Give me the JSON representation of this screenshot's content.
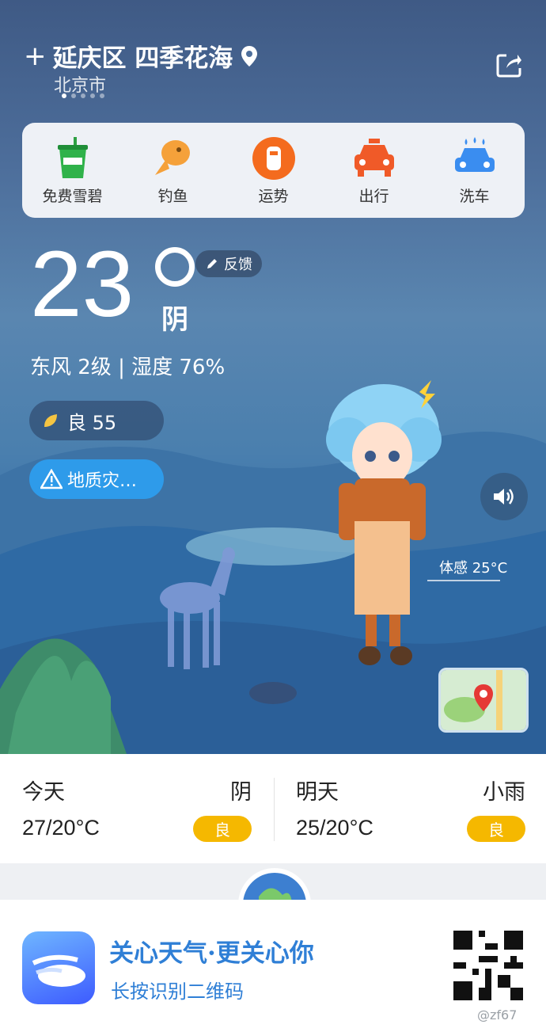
{
  "location": {
    "name": "延庆区 四季花海",
    "city": "北京市",
    "page_dots": 5,
    "active_dot": 0
  },
  "services": [
    {
      "label": "免费雪碧",
      "icon": "soda-cup-icon"
    },
    {
      "label": "钓鱼",
      "icon": "fish-icon"
    },
    {
      "label": "运势",
      "icon": "fortune-icon"
    },
    {
      "label": "出行",
      "icon": "taxi-icon"
    },
    {
      "label": "洗车",
      "icon": "car-wash-icon"
    }
  ],
  "current": {
    "temp": "23",
    "condition": "阴",
    "feedback": "反馈",
    "wind_humidity": "东风 2级 | 湿度 76%",
    "aqi": "良 55",
    "alert": "地质灾…",
    "feels_like": "体感 25°C"
  },
  "forecast": [
    {
      "day": "今天",
      "weather": "阴",
      "range": "27/20°C",
      "quality": "良"
    },
    {
      "day": "明天",
      "weather": "小雨",
      "range": "25/20°C",
      "quality": "良"
    }
  ],
  "banner": {
    "slogan": "关心天气·更关心你",
    "hint": "长按识别二维码"
  },
  "watermark": "@zf67",
  "colors": {
    "accent": "#2e9bea",
    "quality": "#f5b800",
    "brand_text": "#2f7fd6"
  }
}
